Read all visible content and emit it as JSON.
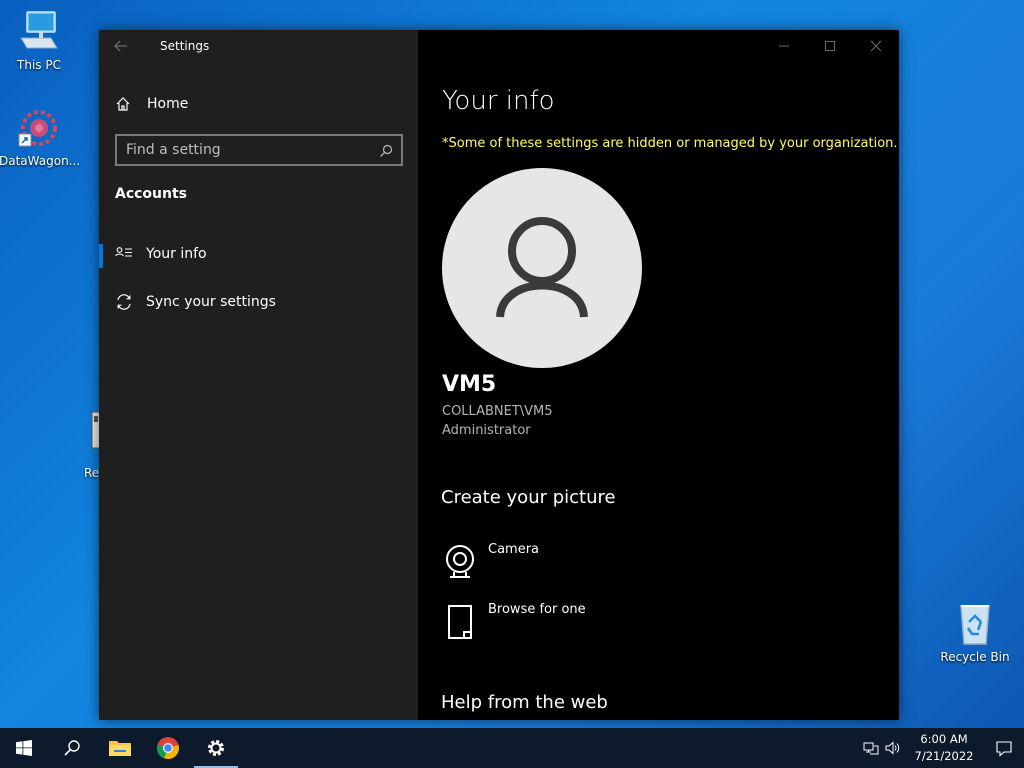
{
  "desktop": {
    "icons": [
      {
        "label": "This PC",
        "icon": "computer-icon"
      },
      {
        "label": "DataWagon...",
        "icon": "datawagon-icon"
      },
      {
        "label": "Recycle Bin",
        "icon": "recycle-bin-icon"
      },
      {
        "label": "Re",
        "icon": "shortcut-icon"
      }
    ]
  },
  "window": {
    "title": "Settings",
    "back_icon": "back-arrow-icon",
    "controls": [
      "minimize-icon",
      "maximize-icon",
      "close-icon"
    ]
  },
  "sidebar": {
    "home_label": "Home",
    "search_placeholder": "Find a setting",
    "section": "Accounts",
    "items": [
      {
        "label": "Your info",
        "icon": "user-info-icon",
        "selected": true
      },
      {
        "label": "Sync your settings",
        "icon": "sync-icon",
        "selected": false
      }
    ]
  },
  "main": {
    "title": "Your info",
    "warning": "*Some of these settings are hidden or managed by your organization.",
    "user": {
      "name": "VM5",
      "domain": "COLLABNET\\VM5",
      "role": "Administrator"
    },
    "create_picture_heading": "Create your picture",
    "actions": [
      {
        "label": "Camera",
        "icon": "camera-icon"
      },
      {
        "label": "Browse for one",
        "icon": "browse-file-icon"
      }
    ],
    "help_heading": "Help from the web",
    "colors": {
      "warning": "#ffff66",
      "accent": "#0078d7"
    }
  },
  "taskbar": {
    "apps": [
      "windows-start-icon",
      "search-icon",
      "file-explorer-icon",
      "chrome-icon",
      "settings-gear-icon"
    ],
    "time": "6:00 AM",
    "date": "7/21/2022"
  }
}
